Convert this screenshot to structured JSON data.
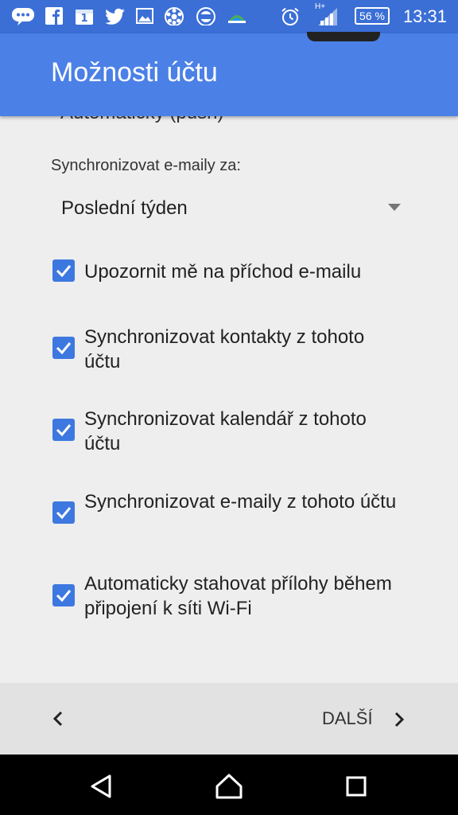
{
  "status_bar": {
    "time": "13:31",
    "battery": "56 %",
    "network_type": "H+",
    "icons": [
      "messenger-icon",
      "facebook-icon",
      "calendar-icon",
      "twitter-icon",
      "gallery-icon",
      "soccer-icon",
      "app-icon",
      "weather-icon",
      "alarm-icon",
      "signal-icon",
      "battery-icon"
    ],
    "calendar_day": "1"
  },
  "app_bar": {
    "title": "Možnosti účtu"
  },
  "content": {
    "cut_text": "Automaticky (push)",
    "sync_label": "Synchronizovat e-maily za:",
    "sync_value": "Poslední týden",
    "checkboxes": [
      {
        "label": "Upozornit mě na příchod e-mailu",
        "checked": true
      },
      {
        "label": "Synchronizovat kontakty z tohoto účtu",
        "checked": true
      },
      {
        "label": "Synchronizovat kalendář z tohoto účtu",
        "checked": true
      },
      {
        "label": "Synchronizovat e-maily z tohoto účtu",
        "checked": true
      },
      {
        "label": "Automaticky stahovat přílohy během připojení k síti Wi-Fi",
        "checked": true
      }
    ]
  },
  "bottom_nav": {
    "next_label": "DALŠÍ"
  },
  "colors": {
    "status_bar": "#3b6fd6",
    "app_bar": "#4b80e6",
    "checkbox": "#3d78e0"
  }
}
